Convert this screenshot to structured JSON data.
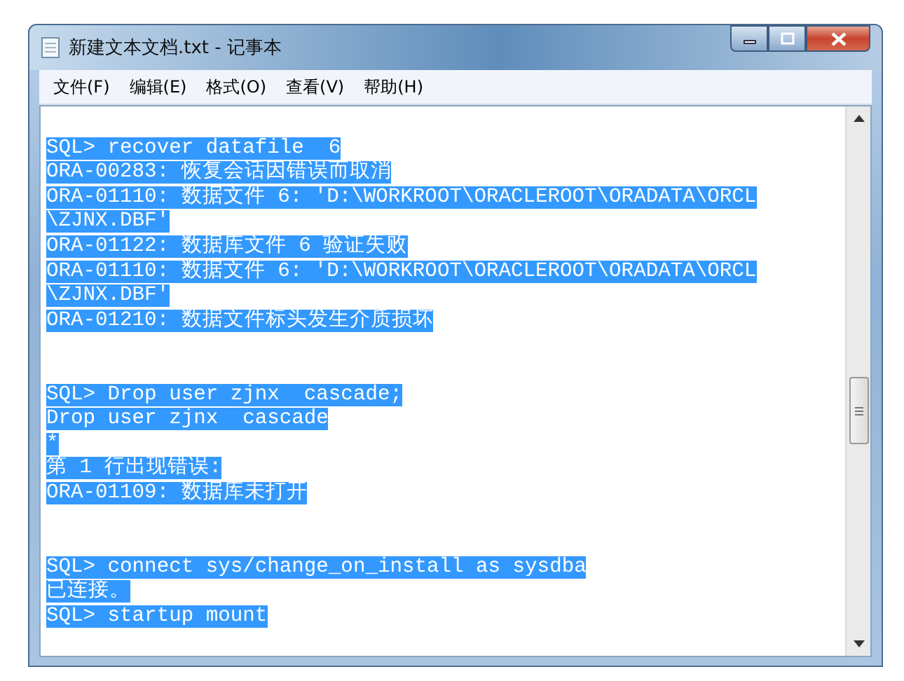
{
  "window": {
    "title": "新建文本文档.txt - 记事本"
  },
  "menu": [
    "文件(F)",
    "编辑(E)",
    "格式(O)",
    "查看(V)",
    "帮助(H)"
  ],
  "blocks": [
    {
      "selected": true,
      "lines": [
        "SQL> recover datafile  6",
        "ORA-00283: 恢复会话因错误而取消",
        "ORA-01110: 数据文件 6: 'D:\\WORKROOT\\ORACLEROOT\\ORADATA\\ORCL",
        "\\ZJNX.DBF'",
        "ORA-01122: 数据库文件 6 验证失败",
        "ORA-01110: 数据文件 6: 'D:\\WORKROOT\\ORACLEROOT\\ORADATA\\ORCL",
        "\\ZJNX.DBF'",
        "ORA-01210: 数据文件标头发生介质损坏"
      ]
    },
    {
      "selected": true,
      "lines": [
        "SQL> Drop user zjnx  cascade;",
        "Drop user zjnx  cascade",
        "*",
        "第 1 行出现错误:",
        "ORA-01109: 数据库未打开"
      ]
    },
    {
      "selected": true,
      "lines": [
        "SQL> connect sys/change_on_install as sysdba",
        "已连接。",
        "SQL> startup mount"
      ]
    }
  ]
}
